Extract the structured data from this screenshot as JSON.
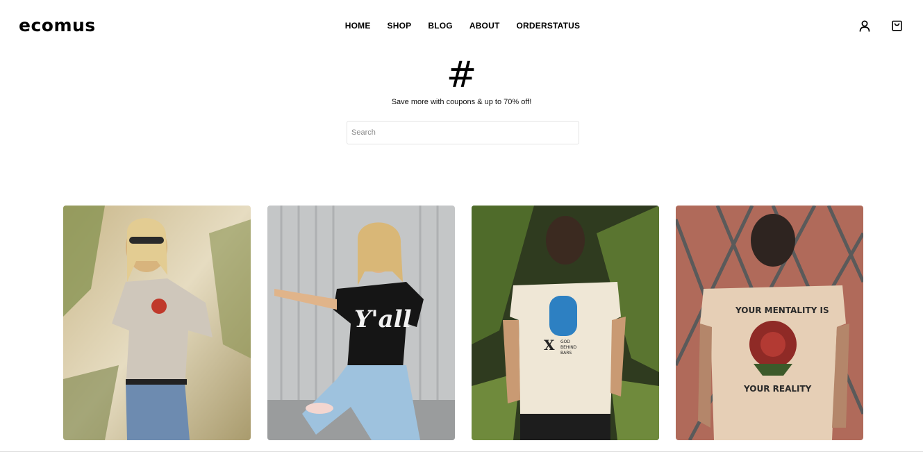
{
  "brand": {
    "logo": "ecomus"
  },
  "nav": {
    "items": [
      "HOME",
      "SHOP",
      "BLOG",
      "ABOUT",
      "ORDERSTATUS"
    ]
  },
  "header_icons": {
    "account": "user-icon",
    "cart": "shopping-bag-icon"
  },
  "hero": {
    "symbol": "#",
    "subtitle": "Save more with coupons & up to 70% off!"
  },
  "search": {
    "placeholder": "Search",
    "value": ""
  },
  "products": [
    {
      "image": "woman-grey-tee-sunglasses"
    },
    {
      "image": "woman-black-yall-tee"
    },
    {
      "image": "man-cream-tee-back-print",
      "print_text": "GOD BEHIND BARS"
    },
    {
      "image": "man-tan-tee-rose-print",
      "print_text": "YOUR MENTALITY IS YOUR REALITY"
    }
  ],
  "colors": {
    "text": "#000000",
    "border": "#e3e3e3"
  }
}
